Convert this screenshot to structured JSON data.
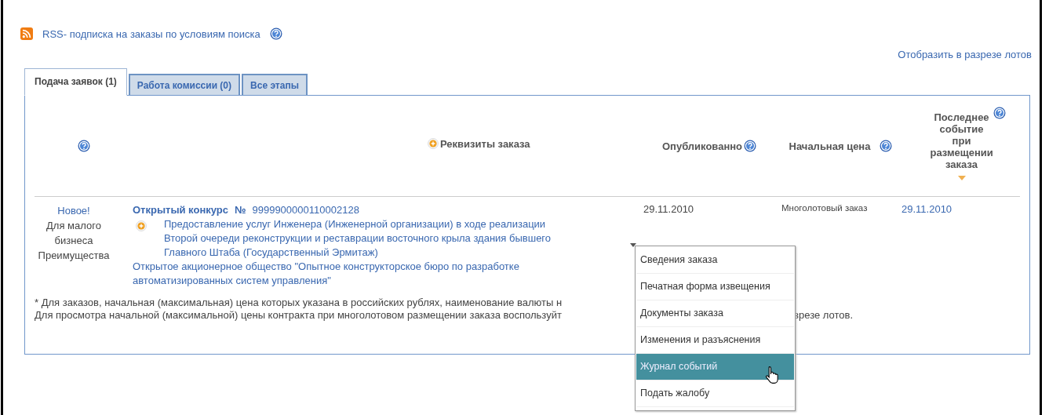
{
  "rss": {
    "label": "RSS- подписка на заказы по условиям поиска",
    "help": true
  },
  "view_link": "Отобразить в разрезе лотов",
  "tabs": [
    {
      "label": "Подача заявок (1)",
      "selected": true
    },
    {
      "label": "Работа комиссии (0)",
      "selected": false
    },
    {
      "label": "Все этапы",
      "selected": false
    }
  ],
  "columns": [
    {
      "help": true,
      "expand": false,
      "sorted": false
    },
    {
      "label": "Реквизиты заказа",
      "help": false,
      "expand": true,
      "sorted": false
    },
    {
      "label": "Опубликованно",
      "help": true,
      "expand": false,
      "sorted": false
    },
    {
      "label": "Начальная цена",
      "help": true,
      "expand": false,
      "sorted": false
    },
    {
      "label": "Последнее событие при размещении заказа",
      "help": true,
      "expand": false,
      "sorted": true
    }
  ],
  "rows": [
    {
      "badges": [
        {
          "kind": "link",
          "text": "Новое!"
        },
        {
          "kind": "text",
          "text": "Для малого бизнеса"
        },
        {
          "kind": "text",
          "text": "Преимущества"
        }
      ],
      "order_type": "Открытый конкурс",
      "number_sign": "№",
      "number": "9999900000110002128",
      "title": "Предоставление услуг Инженера (Инженерной организации) в ходе реализации Второй очереди реконструкции и реставрации восточного крыла здания бывшего Главного Штаба (Государственный Эрмитаж)",
      "customer": "Открытое акционерное общество \"Опытное конструкторское бюро по разработке автоматизированных систем управления\"",
      "published": "29.11.2010",
      "price": "Многолотовый заказ",
      "last_event": "29.11.2010"
    }
  ],
  "footnotes": [
    "* Для заказов, начальная (максимальная) цена которых указана в российских рублях, наименование валюты н",
    "Для просмотра начальной (максимальной) цены контракта при многолотовом размещении заказа воспользуйт",
    "зрезе лотов."
  ],
  "menu": [
    {
      "label": "Сведения заказа",
      "selected": false
    },
    {
      "label": "Печатная форма извещения",
      "selected": false
    },
    {
      "label": "Документы заказа",
      "selected": false
    },
    {
      "label": "Изменения и разъяснения",
      "selected": false
    },
    {
      "label": "Журнал событий",
      "selected": true
    },
    {
      "label": "Подать жалобу",
      "selected": false
    }
  ]
}
